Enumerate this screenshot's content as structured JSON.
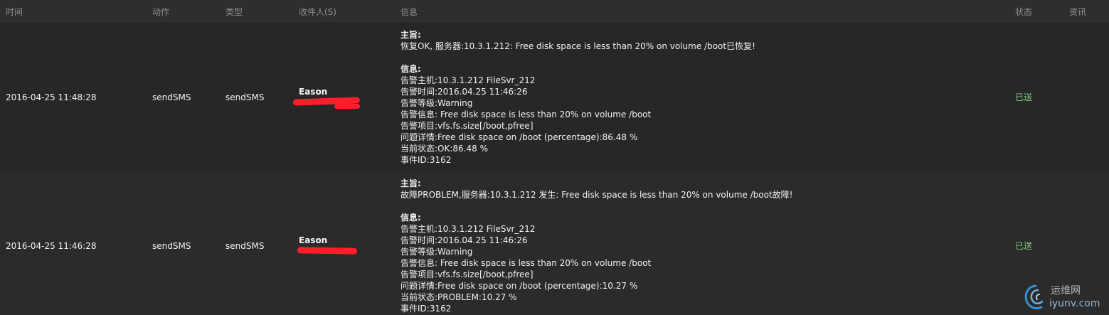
{
  "columns": {
    "time": "时间",
    "action": "动作",
    "type": "类型",
    "recipient": "收件人(S)",
    "message": "信息",
    "status": "状态",
    "info": "资讯"
  },
  "rows": [
    {
      "time": "2016-04-25 11:48:28",
      "action": "sendSMS",
      "type": "sendSMS",
      "recipient": "Eason",
      "message": {
        "subject_label": "主旨:",
        "subject": "恢复OK, 服务器:10.3.1.212: Free disk space is less than 20% on volume /boot已恢复!",
        "info_label": "信息:",
        "lines": [
          "告警主机:10.3.1.212 FileSvr_212",
          "告警时间:2016.04.25 11:46:26",
          "告警等级:Warning",
          "告警信息: Free disk space is less than 20% on volume /boot",
          "告警项目:vfs.fs.size[/boot,pfree]",
          "问题详情:Free disk space on /boot (percentage):86.48 %",
          "当前状态:OK:86.48 %",
          "事件ID:3162"
        ]
      },
      "status": "已送"
    },
    {
      "time": "2016-04-25 11:46:28",
      "action": "sendSMS",
      "type": "sendSMS",
      "recipient": "Eason",
      "message": {
        "subject_label": "主旨:",
        "subject": "故障PROBLEM,服务器:10.3.1.212 发生: Free disk space is less than 20% on volume /boot故障!",
        "info_label": "信息:",
        "lines": [
          "告警主机:10.3.1.212 FileSvr_212",
          "告警时间:2016.04.25 11:46:26",
          "告警等级:Warning",
          "告警信息: Free disk space is less than 20% on volume /boot",
          "告警项目:vfs.fs.size[/boot,pfree]",
          "问题详情:Free disk space on /boot (percentage):10.27 %",
          "当前状态:PROBLEM:10.27 %",
          "事件ID:3162"
        ]
      },
      "status": "已送"
    }
  ],
  "watermark": {
    "top": "运维网",
    "bottom": "iyunv.com"
  },
  "colors": {
    "status_sent": "#7ed07e",
    "redaction": "#ff1e2a",
    "header_text": "#8f8f8f"
  }
}
